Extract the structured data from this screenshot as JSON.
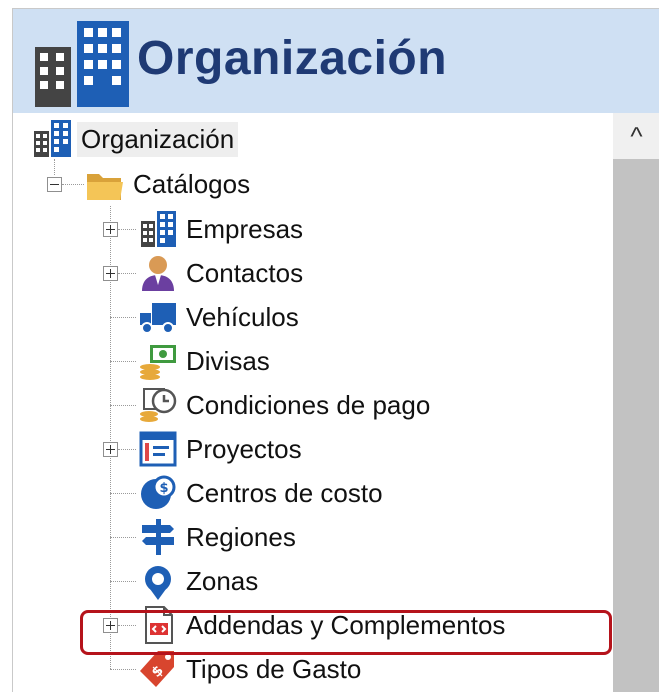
{
  "header": {
    "title": "Organización",
    "icon": "organization-buildings-icon"
  },
  "tree": {
    "root": {
      "label": "Organización",
      "icon": "organization-buildings-icon"
    },
    "catalogos": {
      "label": "Catálogos",
      "icon": "folder-open-icon",
      "expanded": true
    },
    "items": [
      {
        "label": "Empresas",
        "icon": "buildings-icon",
        "expandable": true
      },
      {
        "label": "Contactos",
        "icon": "contact-person-icon",
        "expandable": true
      },
      {
        "label": "Vehículos",
        "icon": "truck-icon",
        "expandable": false
      },
      {
        "label": "Divisas",
        "icon": "currency-icon",
        "expandable": false
      },
      {
        "label": "Condiciones de pago",
        "icon": "payment-terms-clock-icon",
        "expandable": false
      },
      {
        "label": "Proyectos",
        "icon": "projects-board-icon",
        "expandable": true
      },
      {
        "label": "Centros de costo",
        "icon": "cost-center-pie-icon",
        "expandable": false
      },
      {
        "label": "Regiones",
        "icon": "signpost-icon",
        "expandable": false
      },
      {
        "label": "Zonas",
        "icon": "map-pin-icon",
        "expandable": false
      },
      {
        "label": "Addendas y Complementos",
        "icon": "xml-document-icon",
        "expandable": true,
        "highlighted": true
      },
      {
        "label": "Tipos de Gasto",
        "icon": "expense-tag-icon",
        "expandable": false
      }
    ]
  },
  "scrollbar": {
    "up_arrow": "^"
  },
  "colors": {
    "header_bg": "#cfe0f3",
    "title": "#1f3a74",
    "highlight_border": "#b5131b",
    "icon_blue": "#1e5fb5"
  }
}
